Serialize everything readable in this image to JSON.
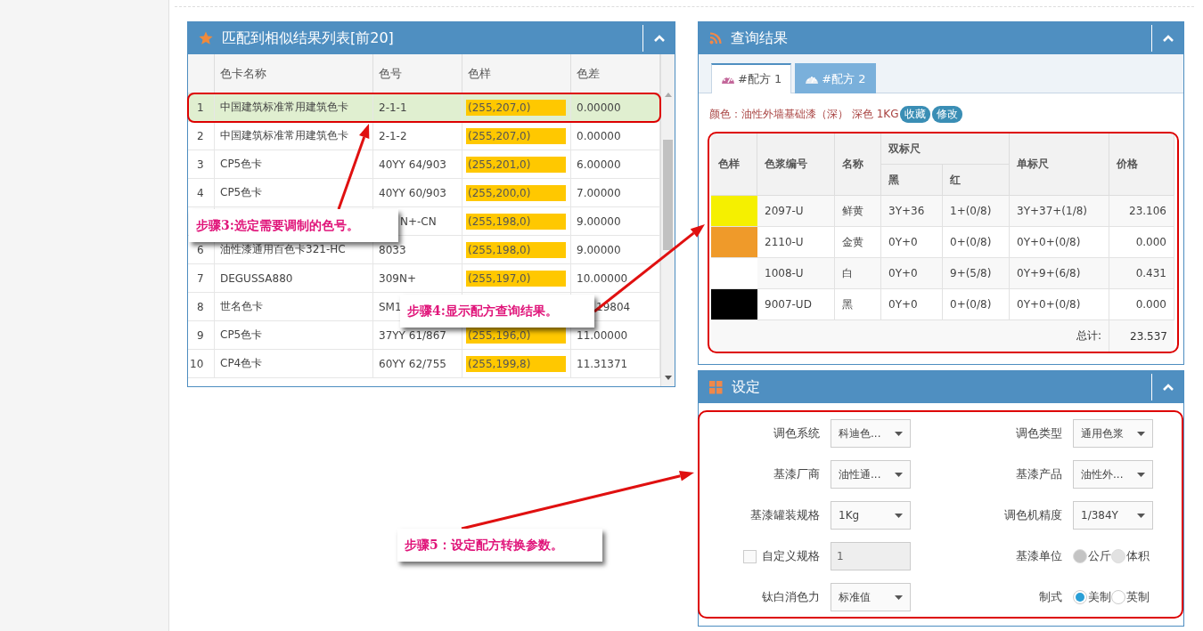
{
  "results_panel": {
    "title": "匹配到相似结果列表[前20]",
    "columns": [
      "色卡名称",
      "色号",
      "色样",
      "色差"
    ],
    "rows": [
      {
        "index": "1",
        "name": "中国建筑标准常用建筑色卡",
        "code": "2-1-1",
        "swatch": "(255,207,0)",
        "diff": "0.00000",
        "selected": true
      },
      {
        "index": "2",
        "name": "中国建筑标准常用建筑色卡",
        "code": "2-1-2",
        "swatch": "(255,207,0)",
        "diff": "0.00000",
        "selected": false
      },
      {
        "index": "3",
        "name": "CP5色卡",
        "code": "40YY 64/903",
        "swatch": "(255,201,0)",
        "diff": "6.00000",
        "selected": false
      },
      {
        "index": "4",
        "name": "CP5色卡",
        "code": "40YY 60/903",
        "swatch": "(255,200,0)",
        "diff": "7.00000",
        "selected": false
      },
      {
        "kind": "covered_left",
        "code": "N+-CN",
        "swatch": "(255,198,0)",
        "diff": "9.00000",
        "selected": false
      },
      {
        "index": "6",
        "name": "油性漆通用百色卡321-HC",
        "code": "8033",
        "swatch": "(255,198,0)",
        "diff": "9.00000",
        "selected": false
      },
      {
        "index": "7",
        "name": "DEGUSSA880",
        "code": "309N+",
        "swatch": "(255,197,0)",
        "diff": "10.00000",
        "selected": false
      },
      {
        "kind": "covered_middle",
        "index": "8",
        "name": "世名色卡",
        "code": "SM1",
        "diff": "19804",
        "selected": false
      },
      {
        "index": "9",
        "name": "CP5色卡",
        "code": "37YY 61/867",
        "swatch": "(255,196,0)",
        "diff": "11.00000",
        "selected": false
      },
      {
        "index": "10",
        "name": "CP4色卡",
        "code": "60YY 62/755",
        "swatch": "(255,199,8)",
        "diff": "11.31371",
        "selected": false
      }
    ]
  },
  "query_panel": {
    "title": "查询结果",
    "tabs": [
      {
        "label": "#配方 1",
        "selected": true
      },
      {
        "label": "#配方 2",
        "selected": false
      }
    ],
    "color_label": "颜色：油性外墙基础漆（深） 深色 1KG",
    "actions": [
      "收藏",
      "修改"
    ],
    "table": {
      "columns": {
        "swatch": "色样",
        "code": "色浆编号",
        "name": "名称",
        "dual": "双标尺",
        "black": "黑",
        "red": "红",
        "single": "单标尺",
        "price": "价格"
      },
      "rows": [
        {
          "color": "#f5f000",
          "code": "2097-U",
          "name": "鲜黄",
          "black": "3Y+36",
          "red": "1+(0/8)",
          "single": "3Y+37+(1/8)",
          "price": "23.106"
        },
        {
          "color": "#ef9a2a",
          "code": "2110-U",
          "name": "金黄",
          "black": "0Y+0",
          "red": "0+(0/8)",
          "single": "0Y+0+(0/8)",
          "price": "0.000"
        },
        {
          "color": "#ffffff",
          "code": "1008-U",
          "name": "白",
          "black": "0Y+0",
          "red": "9+(5/8)",
          "single": "0Y+9+(6/8)",
          "price": "0.431"
        },
        {
          "color": "#000000",
          "code": "9007-UD",
          "name": "黑",
          "black": "0Y+0",
          "red": "0+(0/8)",
          "single": "0Y+0+(0/8)",
          "price": "0.000"
        }
      ],
      "total_label": "总计:",
      "total": "23.537"
    }
  },
  "settings_panel": {
    "title": "设定",
    "fields": [
      {
        "kind": "select",
        "label": "调色系统",
        "value": "科迪色..."
      },
      {
        "kind": "select",
        "label": "调色类型",
        "value": "通用色浆"
      },
      {
        "kind": "select",
        "label": "基漆厂商",
        "value": "油性通..."
      },
      {
        "kind": "select",
        "label": "基漆产品",
        "value": "油性外..."
      },
      {
        "kind": "select",
        "label": "基漆罐装规格",
        "value": "1Kg"
      },
      {
        "kind": "select",
        "label": "调色机精度",
        "value": "1/384Y"
      },
      {
        "kind": "checkbox_input",
        "label": "自定义规格",
        "checked": false,
        "value": "1",
        "disabled": true
      },
      {
        "kind": "radio",
        "label": "基漆单位",
        "disabled": true,
        "options": [
          {
            "label": "公斤",
            "selected": true
          },
          {
            "label": "体积",
            "selected": false
          }
        ]
      },
      {
        "kind": "select",
        "label": "钛白消色力",
        "value": "标准值"
      },
      {
        "kind": "radio",
        "label": "制式",
        "disabled": false,
        "options": [
          {
            "label": "美制",
            "selected": true
          },
          {
            "label": "英制",
            "selected": false
          }
        ]
      }
    ]
  },
  "annotations": [
    {
      "text": "步骤3:选定需要调制的色号。"
    },
    {
      "text": "步骤4:显示配方查询结果。"
    },
    {
      "text": "步骤5：设定配方转换参数。"
    }
  ]
}
